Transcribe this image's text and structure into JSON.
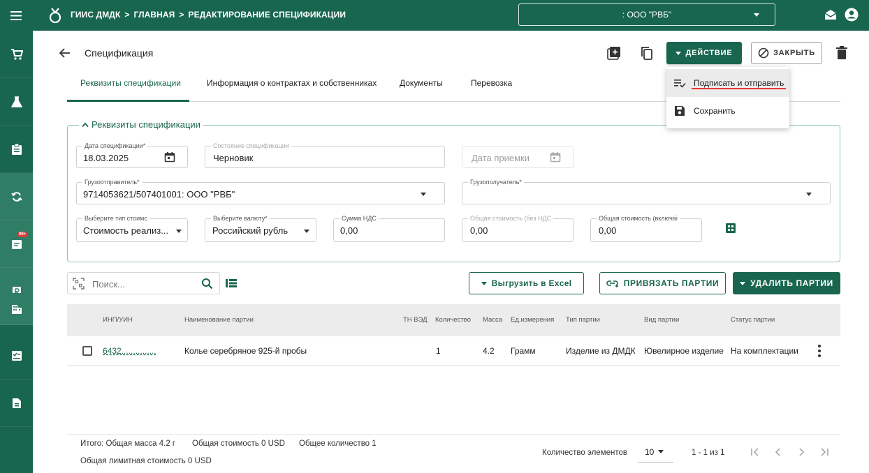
{
  "topbar": {
    "breadcrumb": [
      "ГИИС ДМДК",
      "ГЛАВНАЯ",
      "РЕДАКТИРОВАНИЕ СПЕЦИФИКАЦИИ"
    ],
    "separator": ">",
    "org": ": ООО \"РВБ\"",
    "icons": [
      "menu-icon",
      "logo-icon",
      "mail-icon",
      "account-icon"
    ]
  },
  "sidebar": {
    "items": [
      "cart-icon",
      "flask-icon",
      "clipboard-icon",
      "sync-icon",
      "document-list-icon",
      "ruble-doc-icon",
      "building-icon",
      "checklist-icon",
      "file-icon"
    ],
    "badge": "99+"
  },
  "header": {
    "title": "Спецификация",
    "action_label": "ДЕЙСТВИЕ",
    "close_label": "ЗАКРЫТЬ"
  },
  "tabs": [
    {
      "label": "Реквизиты спецификации",
      "active": true
    },
    {
      "label": "Информация о контрактах и собственниках"
    },
    {
      "label": "Документы"
    },
    {
      "label": "Перевозка"
    }
  ],
  "action_menu": {
    "items": [
      {
        "label": "Подписать и отправить"
      },
      {
        "label": "Сохранить"
      }
    ]
  },
  "section": {
    "title": "Реквизиты спецификации",
    "fields": {
      "spec_date": {
        "label": "Дата спецификации*",
        "value": "18.03.2025"
      },
      "state": {
        "label": "Состояние спецификации",
        "value": "Черновик"
      },
      "accept_date": {
        "placeholder": "Дата приемки"
      },
      "shipper": {
        "label": "Грузоотправитель*",
        "value": "9714053621/507401001: ООО \"РВБ\""
      },
      "consignee": {
        "label": "Грузополучатель*",
        "value": ""
      },
      "cost_type": {
        "label": "Выберите тип стоимс",
        "value": "Стоимость реализ..."
      },
      "currency": {
        "label": "Выберите валюту*",
        "value": "Российский рубль"
      },
      "vat": {
        "label": "Сумма НДС",
        "value": "0,00"
      },
      "total_no_vat": {
        "label": "Общая стоимость (без НДС",
        "value": "0,00"
      },
      "total_vat": {
        "label": "Общая стоимость (включаі",
        "value": "0,00"
      }
    }
  },
  "toolbar": {
    "search_placeholder": "Поиск...",
    "export_label": "Выгрузить в Excel",
    "bind_label": "ПРИВЯЗАТЬ ПАРТИИ",
    "delete_label": "УДАЛИТЬ ПАРТИИ"
  },
  "table": {
    "headers": [
      "ИНП/УИН",
      "Наименование партии",
      "ТН ВЭД",
      "Количество",
      "Масса",
      "Ед.измерения",
      "Тип партии",
      "Вид партии",
      "Статус партии"
    ],
    "rows": [
      {
        "inp": "6432...............",
        "name": "Колье серебряное 925-й пробы",
        "tnved": "",
        "qty": "1",
        "mass": "4.2",
        "unit": "Грамм",
        "type": "Изделие из ДМДК",
        "kind": "Ювелирное изделие",
        "status": "На комплектации"
      }
    ]
  },
  "footer": {
    "total_mass": "Итого: Общая масса 4.2 г",
    "total_cost": "Общая стоимость 0 USD",
    "total_qty": "Общее количество 1",
    "limit_cost": "Общая лимитная стоимость 0 USD",
    "per_page_label": "Количество элементов",
    "per_page": "10",
    "range": "1 - 1 из 1"
  },
  "colors": {
    "brand": "#19664e",
    "accent_underline": "#e53935"
  }
}
